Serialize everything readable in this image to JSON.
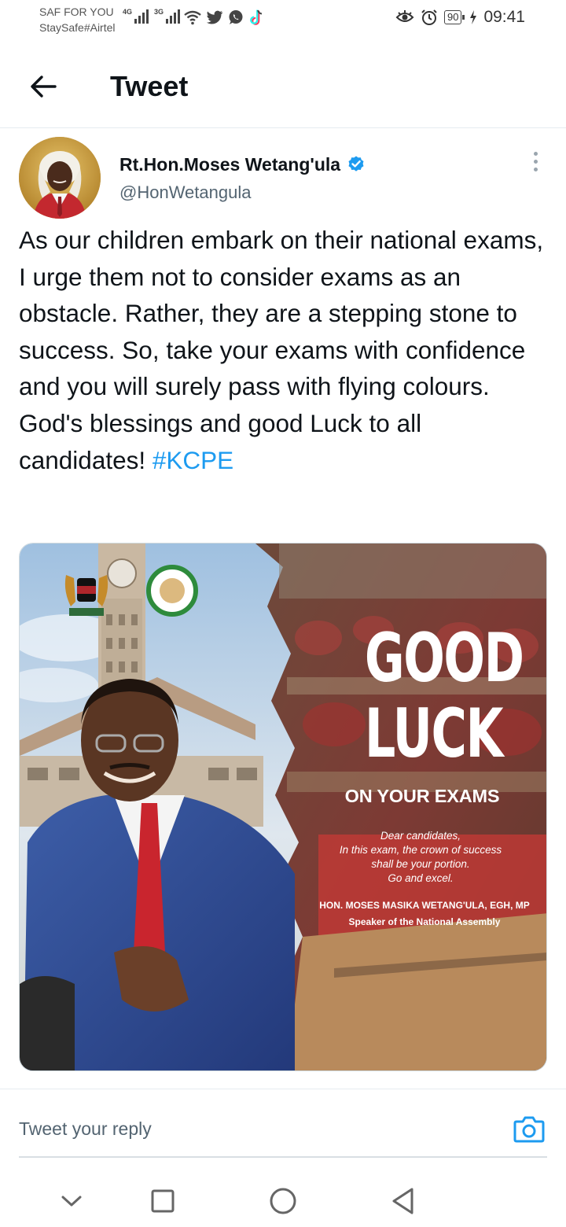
{
  "status_bar": {
    "carrier_line1": "SAF FOR YOU",
    "carrier_line2": "StaySafe#Airtel",
    "signal1_tag": "4G",
    "signal2_tag": "3G",
    "battery": "90",
    "time": "09:41"
  },
  "header": {
    "title": "Tweet",
    "back_icon": "arrow-left-icon"
  },
  "tweet": {
    "author_name": "Rt.Hon.Moses Wetang'ula",
    "verified": true,
    "handle": "@HonWetangula",
    "text": "As our children embark on their national exams, I urge them not to consider exams as an obstacle. Rather, they are a stepping stone to success. So, take your exams with confidence and you will surely pass with flying colours. God's blessings and good Luck to all candidates!",
    "hashtag": "#KCPE",
    "more_icon": "more-vertical-icon"
  },
  "media": {
    "headline1": "GOOD",
    "headline2": "LUCK",
    "headline3": "ON YOUR EXAMS",
    "message_lines": [
      "Dear candidates,",
      "In this exam, the crown of success",
      "shall be your portion.",
      "Go and excel."
    ],
    "signature_name": "HON. MOSES MASIKA WETANG'ULA, EGH, MP",
    "signature_title": "Speaker of the National Assembly"
  },
  "reply": {
    "placeholder": "Tweet your reply",
    "camera_icon": "camera-icon"
  },
  "nav": {
    "icons": [
      "chevron-down-icon",
      "square-icon",
      "circle-icon",
      "triangle-back-icon"
    ]
  },
  "colors": {
    "accent": "#1d9bf0",
    "text": "#0f1419",
    "secondary": "#536471"
  }
}
